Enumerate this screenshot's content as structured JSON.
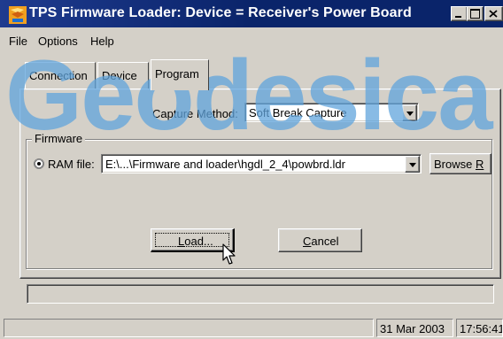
{
  "window": {
    "title": "TPS Firmware Loader:  Device = Receiver's Power Board",
    "controls": {
      "minimize": "_",
      "maximize": "□",
      "close": "X"
    }
  },
  "menu": {
    "items": [
      "File",
      "Options",
      "Help"
    ]
  },
  "watermark": {
    "text": "Geodesica"
  },
  "tabs": [
    {
      "label": "Connection",
      "selected": false
    },
    {
      "label": "Device",
      "selected": false
    },
    {
      "label": "Program",
      "selected": true
    }
  ],
  "program": {
    "capture_method_label": "Capture Method:",
    "capture_method_value": "Soft Break Capture",
    "firmware_group_label": "Firmware",
    "ram_file_label": "RAM file:",
    "ram_file_path": "E:\\...\\Firmware and loader\\hgdl_2_4\\powbrd.ldr",
    "browse_label_prefix": "Browse ",
    "browse_label_accel": "R",
    "load_label_prefix": "",
    "load_label_accel": "L",
    "load_label_rest": "oad...",
    "cancel_label_prefix": "",
    "cancel_label_accel": "C",
    "cancel_label_rest": "ancel",
    "progress": 0
  },
  "statusbar": {
    "date": "31 Mar 2003",
    "time": "17:56:41"
  }
}
